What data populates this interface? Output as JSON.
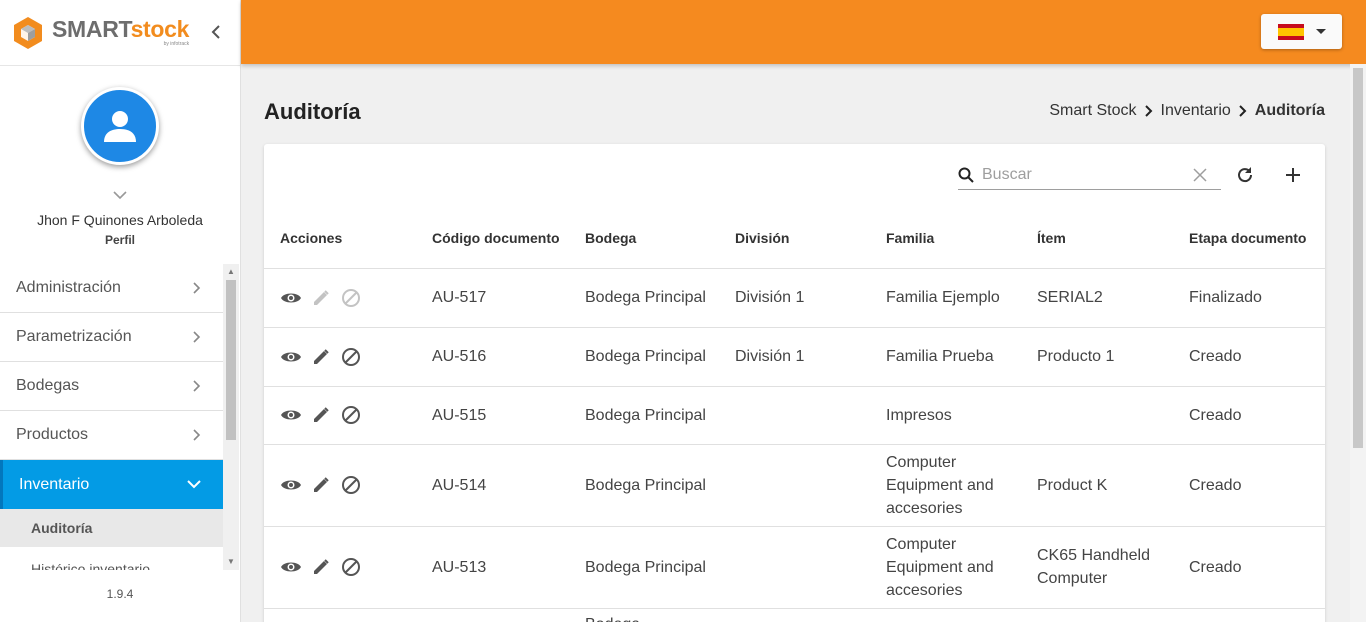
{
  "brand": {
    "name_part1": "SMART",
    "name_part2": "stock",
    "sub": "by infotrack"
  },
  "user": {
    "name": "Jhon F Quinones Arboleda",
    "profile_link": "Perfil"
  },
  "menu": {
    "items": [
      {
        "label": "Administración"
      },
      {
        "label": "Parametrización"
      },
      {
        "label": "Bodegas"
      },
      {
        "label": "Productos"
      },
      {
        "label": "Inventario"
      }
    ],
    "submenu": [
      {
        "label": "Auditoría"
      },
      {
        "label": "Histórico inventario"
      }
    ]
  },
  "version": "1.9.4",
  "page": {
    "title": "Auditoría",
    "breadcrumb": [
      "Smart Stock",
      "Inventario",
      "Auditoría"
    ]
  },
  "search": {
    "placeholder": "Buscar"
  },
  "table": {
    "headers": {
      "actions": "Acciones",
      "code": "Código documento",
      "warehouse": "Bodega",
      "division": "División",
      "family": "Familia",
      "item": "Ítem",
      "stage": "Etapa documento"
    },
    "rows": [
      {
        "code": "AU-517",
        "warehouse": "Bodega Principal",
        "division": "División 1",
        "family": "Familia Ejemplo",
        "item": "SERIAL2",
        "stage": "Finalizado"
      },
      {
        "code": "AU-516",
        "warehouse": "Bodega Principal",
        "division": "División 1",
        "family": "Familia Prueba",
        "item": "Producto 1",
        "stage": "Creado"
      },
      {
        "code": "AU-515",
        "warehouse": "Bodega Principal",
        "division": "",
        "family": "Impresos",
        "item": "",
        "stage": "Creado"
      },
      {
        "code": "AU-514",
        "warehouse": "Bodega Principal",
        "division": "",
        "family": "Computer Equipment and accesories",
        "item": "Product K",
        "stage": "Creado"
      },
      {
        "code": "AU-513",
        "warehouse": "Bodega Principal",
        "division": "",
        "family": "Computer Equipment and accesories",
        "item": "CK65 Handheld Computer",
        "stage": "Creado"
      },
      {
        "code": "",
        "warehouse": "Bodega",
        "division": "",
        "family": "",
        "item": "",
        "stage": ""
      }
    ]
  },
  "colors": {
    "topbar": "#f58a1f",
    "active_menu": "#039be5",
    "avatar": "#1e88e5"
  }
}
